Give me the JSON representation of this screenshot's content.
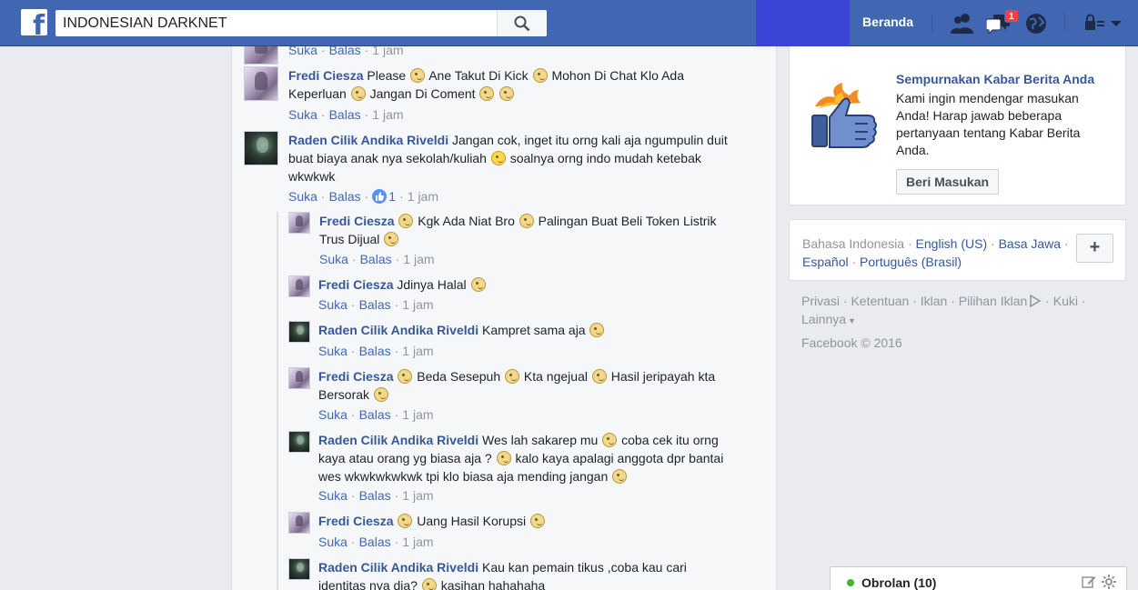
{
  "search": {
    "value": "INDONESIAN DARKNET"
  },
  "nav": {
    "home_label": "Beranda",
    "messages_badge": "1"
  },
  "comments": [
    {
      "name": "",
      "text": "",
      "actions": {
        "like": "Suka",
        "reply": "Balas",
        "time": "1 jam"
      }
    },
    {
      "name": "Fredi Ciesza",
      "segments": [
        "Please",
        "Ane Takut Di Kick",
        "Mohon Di Chat Klo Ada Keperluan",
        "Jangan Di Coment"
      ],
      "actions": {
        "like": "Suka",
        "reply": "Balas",
        "time": "1 jam"
      }
    },
    {
      "name": "Raden Cilik Andika Riveldi",
      "segments": [
        "Jangan cok, inget itu orng kali aja ngumpulin duit buat biaya anak nya sekolah/kuliah",
        "soalnya orng indo mudah ketebak wkwkwk"
      ],
      "actions": {
        "like": "Suka",
        "reply": "Balas",
        "reactions": "1",
        "time": "1 jam"
      }
    }
  ],
  "replies": [
    {
      "name": "Fredi Ciesza",
      "segments": [
        "Kgk Ada Niat Bro",
        "Palingan Buat Beli Token Listrik Trus Dijual"
      ],
      "actions": {
        "like": "Suka",
        "reply": "Balas",
        "time": "1 jam"
      }
    },
    {
      "name": "Fredi Ciesza",
      "segments": [
        "Jdinya Halal"
      ],
      "actions": {
        "like": "Suka",
        "reply": "Balas",
        "time": "1 jam"
      }
    },
    {
      "name": "Raden Cilik Andika Riveldi",
      "segments": [
        "Kampret sama aja"
      ],
      "actions": {
        "like": "Suka",
        "reply": "Balas",
        "time": "1 jam"
      }
    },
    {
      "name": "Fredi Ciesza",
      "segments": [
        "Beda Sesepuh",
        "Kta ngejual",
        "Hasil jeripayah kta Bersorak"
      ],
      "actions": {
        "like": "Suka",
        "reply": "Balas",
        "time": "1 jam"
      }
    },
    {
      "name": "Raden Cilik Andika Riveldi",
      "segments": [
        "Wes lah sakarep mu",
        "coba cek itu orng kaya atau orang yg biasa aja ?",
        "kalo kaya apalagi anggota dpr bantai wes wkwkwkwkwk tpi klo biasa aja mending jangan"
      ],
      "actions": {
        "like": "Suka",
        "reply": "Balas",
        "time": "1 jam"
      }
    },
    {
      "name": "Fredi Ciesza",
      "segments": [
        "Uang Hasil Korupsi"
      ],
      "actions": {
        "like": "Suka",
        "reply": "Balas",
        "time": "1 jam"
      }
    },
    {
      "name": "Raden Cilik Andika Riveldi",
      "segments": [
        "Kau kan pemain tikus ,coba kau cari identitas nya dia?",
        "kasihan hahahaha"
      ]
    }
  ],
  "feedback_card": {
    "title": "Sempurnakan Kabar Berita Anda",
    "description": "Kami ingin mendengar masukan Anda! Harap jawab beberapa pertanyaan tentang Kabar Berita Anda.",
    "button": "Beri Masukan"
  },
  "languages": {
    "current": "Bahasa Indonesia",
    "options": [
      "English (US)",
      "Basa Jawa",
      "Español",
      "Português (Brasil)"
    ],
    "add_label": "+"
  },
  "footer": {
    "links": [
      "Privasi",
      "Ketentuan",
      "Iklan",
      "Pilihan Iklan",
      "Kuki",
      "Lainnya"
    ],
    "copyright": "Facebook © 2016"
  },
  "chat": {
    "label": "Obrolan (10)"
  },
  "colors": {
    "brand": "#4267b2",
    "link": "#365899",
    "online": "#42b72a",
    "badge": "#fa3e3e"
  }
}
